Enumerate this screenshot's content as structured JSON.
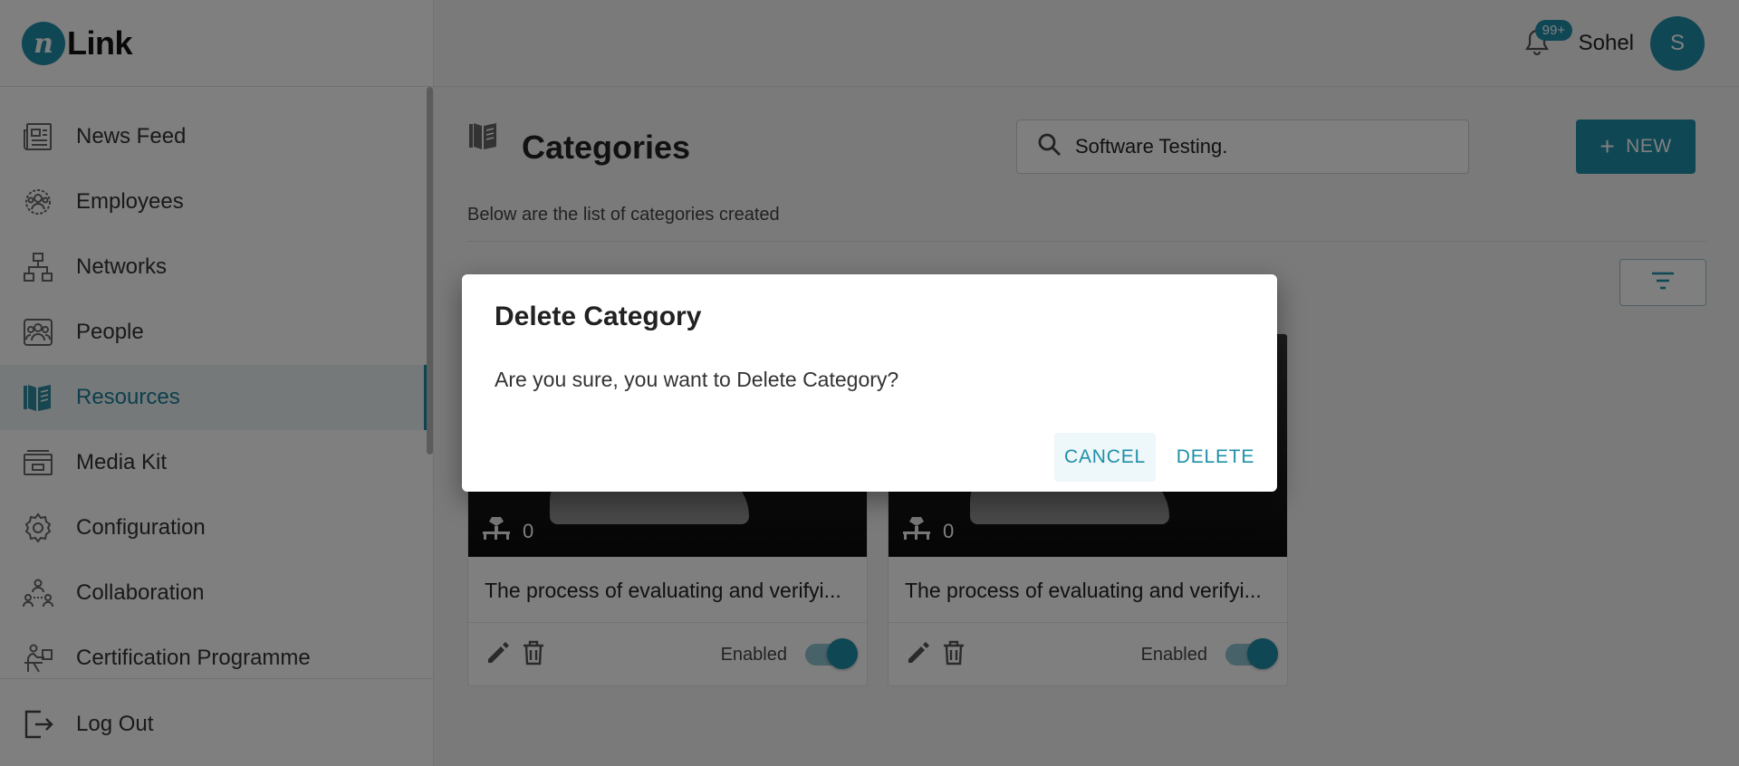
{
  "app": {
    "logo_mark": "n",
    "logo_text": "Link"
  },
  "header": {
    "notification_count": "99+",
    "username": "Sohel",
    "avatar_initial": "S"
  },
  "sidebar": {
    "items": [
      {
        "label": "News Feed",
        "icon": "newspaper-icon",
        "active": false
      },
      {
        "label": "Employees",
        "icon": "employees-icon",
        "active": false
      },
      {
        "label": "Networks",
        "icon": "network-icon",
        "active": false
      },
      {
        "label": "People",
        "icon": "people-icon",
        "active": false
      },
      {
        "label": "Resources",
        "icon": "book-icon",
        "active": true
      },
      {
        "label": "Media Kit",
        "icon": "media-kit-icon",
        "active": false
      },
      {
        "label": "Configuration",
        "icon": "gear-icon",
        "active": false
      },
      {
        "label": "Collaboration",
        "icon": "collaboration-icon",
        "active": false
      },
      {
        "label": "Certification Programme",
        "icon": "certification-icon",
        "active": false
      }
    ],
    "logout_label": "Log Out"
  },
  "main": {
    "title": "Categories",
    "subtitle": "Below are the list of categories created",
    "search": {
      "value": "Software Testing."
    },
    "new_button": {
      "icon": "+",
      "label": "NEW"
    },
    "cards": [
      {
        "count": "0",
        "description": "The process of evaluating and verifyi...",
        "status_label": "Enabled",
        "enabled": true
      },
      {
        "count": "0",
        "description": "The process of evaluating and verifyi...",
        "status_label": "Enabled",
        "enabled": true
      }
    ]
  },
  "dialog": {
    "title": "Delete Category",
    "message": "Are you sure, you want to Delete Category?",
    "cancel_label": "CANCEL",
    "delete_label": "DELETE"
  },
  "colors": {
    "accent": "#1f8fa8",
    "overlay": "rgba(0,0,0,0.5)"
  }
}
